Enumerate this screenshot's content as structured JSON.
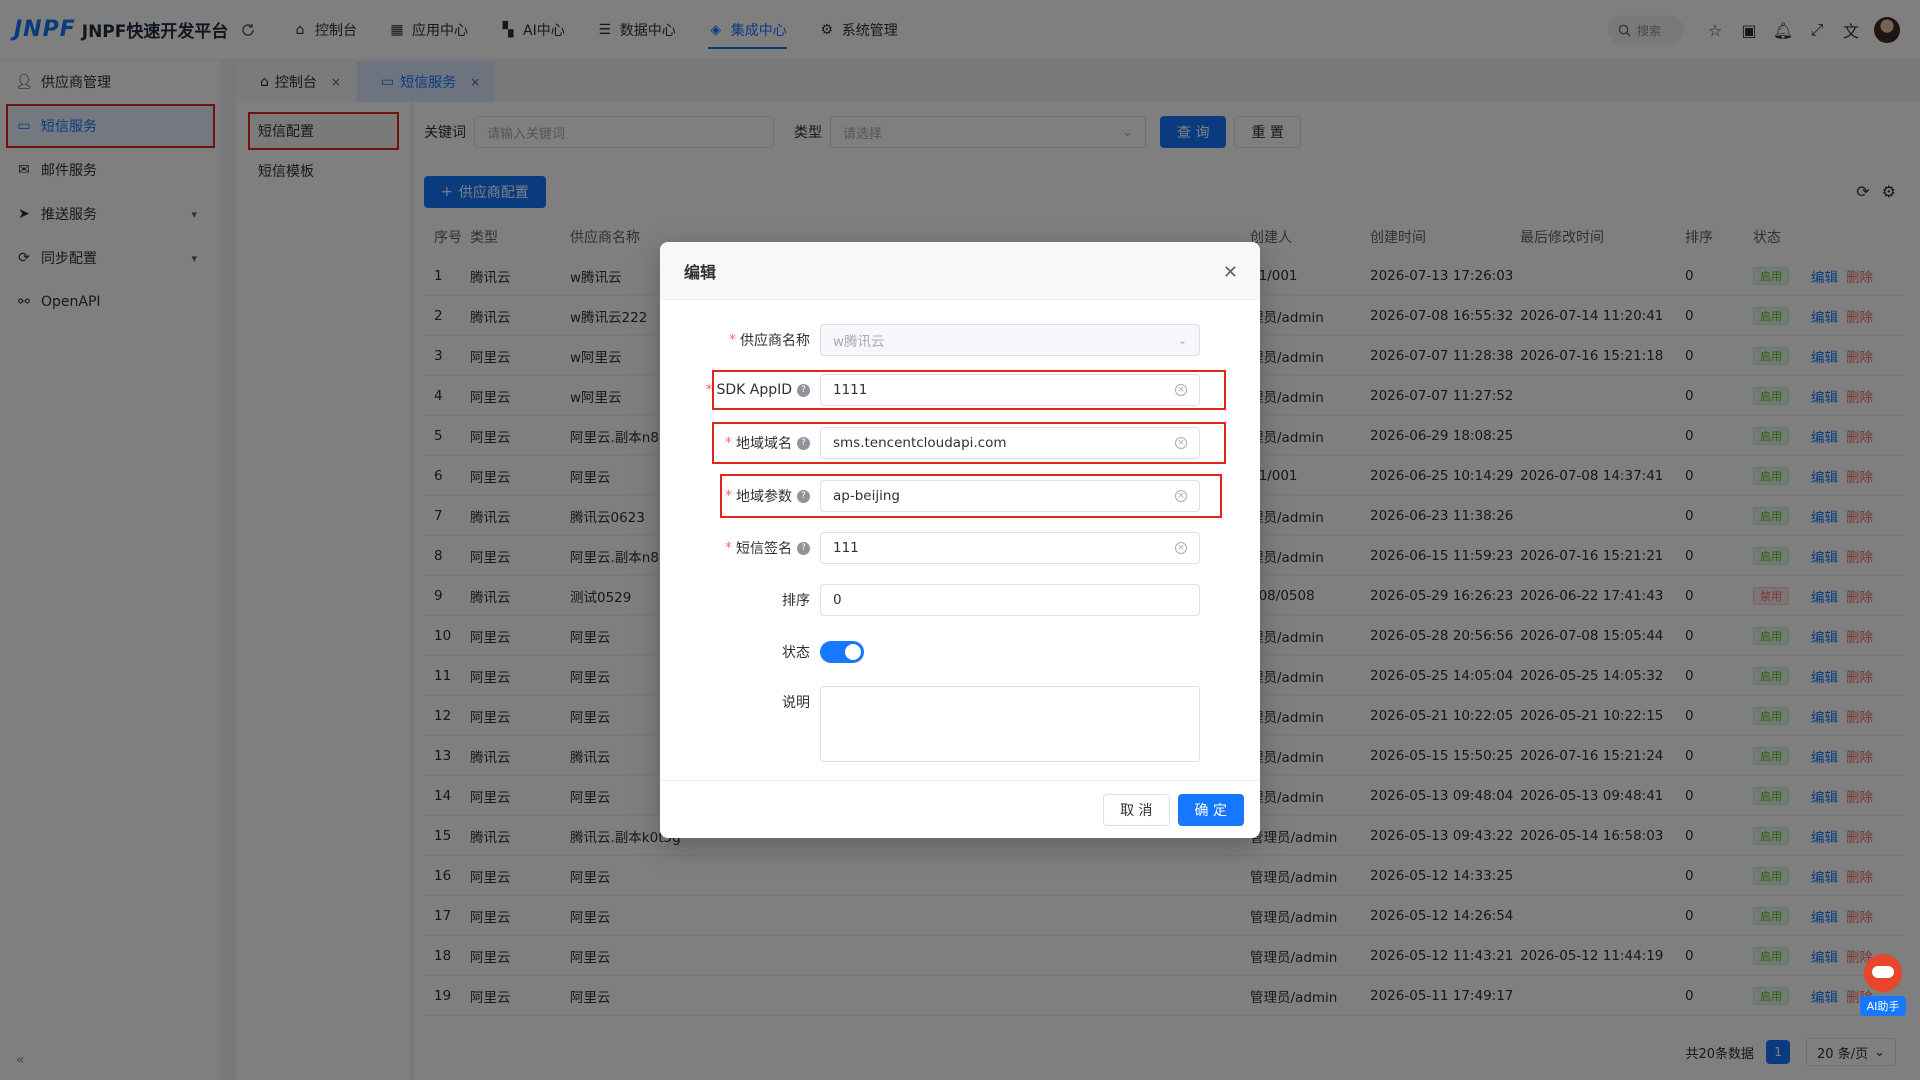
{
  "app": {
    "logo_mark": "JNPF",
    "title": "JNPF快速开发平台"
  },
  "topnav": [
    {
      "label": "控制台",
      "icon": "home-icon"
    },
    {
      "label": "应用中心",
      "icon": "grid-icon"
    },
    {
      "label": "AI中心",
      "icon": "ai-icon"
    },
    {
      "label": "数据中心",
      "icon": "database-icon"
    },
    {
      "label": "集成中心",
      "icon": "integration-icon",
      "active": true
    },
    {
      "label": "系统管理",
      "icon": "gear-icon"
    }
  ],
  "search": {
    "placeholder": "搜索"
  },
  "sidebar": {
    "items": [
      {
        "label": "供应商管理",
        "icon": "user-icon"
      },
      {
        "label": "短信服务",
        "icon": "message-icon",
        "active": true
      },
      {
        "label": "邮件服务",
        "icon": "mail-icon"
      },
      {
        "label": "推送服务",
        "icon": "send-icon",
        "expandable": true
      },
      {
        "label": "同步配置",
        "icon": "sync-icon",
        "expandable": true
      },
      {
        "label": "OpenAPI",
        "icon": "api-icon"
      }
    ]
  },
  "tabs": [
    {
      "label": "控制台",
      "icon": "home-icon"
    },
    {
      "label": "短信服务",
      "icon": "message-icon",
      "active": true
    }
  ],
  "submenu": [
    {
      "label": "短信配置",
      "active": true
    },
    {
      "label": "短信模板"
    }
  ],
  "filter": {
    "keyword_label": "关键词",
    "keyword_placeholder": "请输入关键词",
    "type_label": "类型",
    "type_placeholder": "请选择",
    "query_label": "查 询",
    "reset_label": "重 置"
  },
  "add_button": "供应商配置",
  "table": {
    "columns": [
      "序号",
      "类型",
      "供应商名称",
      "创建人",
      "创建时间",
      "最后修改时间",
      "排序",
      "状态"
    ],
    "edit_label": "编辑",
    "delete_label": "删除",
    "rows": [
      {
        "no": "1",
        "type": "腾讯云",
        "name": "w腾讯云",
        "creator": "01/001",
        "ctime": "2026-07-13 17:26:03",
        "mtime": "",
        "sort": "0",
        "status": "启用"
      },
      {
        "no": "2",
        "type": "腾讯云",
        "name": "w腾讯云222",
        "creator": "理员/admin",
        "ctime": "2026-07-08 16:55:32",
        "mtime": "2026-07-14 11:20:41",
        "sort": "0",
        "status": "启用"
      },
      {
        "no": "3",
        "type": "阿里云",
        "name": "w阿里云",
        "creator": "理员/admin",
        "ctime": "2026-07-07 11:28:38",
        "mtime": "2026-07-16 15:21:18",
        "sort": "0",
        "status": "启用"
      },
      {
        "no": "4",
        "type": "阿里云",
        "name": "w阿里云",
        "creator": "理员/admin",
        "ctime": "2026-07-07 11:27:52",
        "mtime": "",
        "sort": "0",
        "status": "启用"
      },
      {
        "no": "5",
        "type": "阿里云",
        "name": "阿里云.副本n8",
        "creator": "理员/admin",
        "ctime": "2026-06-29 18:08:25",
        "mtime": "",
        "sort": "0",
        "status": "启用"
      },
      {
        "no": "6",
        "type": "阿里云",
        "name": "阿里云",
        "creator": "01/001",
        "ctime": "2026-06-25 10:14:29",
        "mtime": "2026-07-08 14:37:41",
        "sort": "0",
        "status": "启用"
      },
      {
        "no": "7",
        "type": "腾讯云",
        "name": "腾讯云0623",
        "creator": "理员/admin",
        "ctime": "2026-06-23 11:38:26",
        "mtime": "",
        "sort": "0",
        "status": "启用"
      },
      {
        "no": "8",
        "type": "阿里云",
        "name": "阿里云.副本n8",
        "creator": "理员/admin",
        "ctime": "2026-06-15 11:59:23",
        "mtime": "2026-07-16 15:21:21",
        "sort": "0",
        "status": "启用"
      },
      {
        "no": "9",
        "type": "腾讯云",
        "name": "测试0529",
        "creator": "508/0508",
        "ctime": "2026-05-29 16:26:23",
        "mtime": "2026-06-22 17:41:43",
        "sort": "0",
        "status": "禁用"
      },
      {
        "no": "10",
        "type": "阿里云",
        "name": "阿里云",
        "creator": "理员/admin",
        "ctime": "2026-05-28 20:56:56",
        "mtime": "2026-07-08 15:05:44",
        "sort": "0",
        "status": "启用"
      },
      {
        "no": "11",
        "type": "阿里云",
        "name": "阿里云",
        "creator": "理员/admin",
        "ctime": "2026-05-25 14:05:04",
        "mtime": "2026-05-25 14:05:32",
        "sort": "0",
        "status": "启用"
      },
      {
        "no": "12",
        "type": "阿里云",
        "name": "阿里云",
        "creator": "理员/admin",
        "ctime": "2026-05-21 10:22:05",
        "mtime": "2026-05-21 10:22:15",
        "sort": "0",
        "status": "启用"
      },
      {
        "no": "13",
        "type": "腾讯云",
        "name": "腾讯云",
        "creator": "理员/admin",
        "ctime": "2026-05-15 15:50:25",
        "mtime": "2026-07-16 15:21:24",
        "sort": "0",
        "status": "启用"
      },
      {
        "no": "14",
        "type": "阿里云",
        "name": "阿里云",
        "creator": "理员/admin",
        "ctime": "2026-05-13 09:48:04",
        "mtime": "2026-05-13 09:48:41",
        "sort": "0",
        "status": "启用"
      },
      {
        "no": "15",
        "type": "腾讯云",
        "name": "腾讯云.副本k0t5g",
        "creator": "管理员/admin",
        "ctime": "2026-05-13 09:43:22",
        "mtime": "2026-05-14 16:58:03",
        "sort": "0",
        "status": "启用"
      },
      {
        "no": "16",
        "type": "阿里云",
        "name": "阿里云",
        "creator": "管理员/admin",
        "ctime": "2026-05-12 14:33:25",
        "mtime": "",
        "sort": "0",
        "status": "启用"
      },
      {
        "no": "17",
        "type": "阿里云",
        "name": "阿里云",
        "creator": "管理员/admin",
        "ctime": "2026-05-12 14:26:54",
        "mtime": "",
        "sort": "0",
        "status": "启用"
      },
      {
        "no": "18",
        "type": "阿里云",
        "name": "阿里云",
        "creator": "管理员/admin",
        "ctime": "2026-05-12 11:43:21",
        "mtime": "2026-05-12 11:44:19",
        "sort": "0",
        "status": "启用"
      },
      {
        "no": "19",
        "type": "阿里云",
        "name": "阿里云",
        "creator": "管理员/admin",
        "ctime": "2026-05-11 17:49:17",
        "mtime": "",
        "sort": "0",
        "status": "启用"
      }
    ]
  },
  "pager": {
    "total": "共20条数据",
    "page": "1",
    "size": "20 条/页"
  },
  "dialog": {
    "title": "编辑",
    "fields": {
      "provider": {
        "label": "供应商名称",
        "value": "w腾讯云"
      },
      "sdk": {
        "label": "SDK AppID",
        "value": "1111"
      },
      "domain": {
        "label": "地域域名",
        "value": "sms.tencentcloudapi.com"
      },
      "region": {
        "label": "地域参数",
        "value": "ap-beijing"
      },
      "sign": {
        "label": "短信签名",
        "value": "111"
      },
      "sort": {
        "label": "排序",
        "value": "0"
      },
      "status": {
        "label": "状态",
        "value": true
      },
      "desc": {
        "label": "说明",
        "value": ""
      }
    },
    "cancel": "取 消",
    "confirm": "确 定"
  },
  "ai_assistant": {
    "label": "AI助手"
  },
  "colors": {
    "primary": "#1677ff",
    "danger": "#f56c6c",
    "highlight": "#e1251b"
  }
}
